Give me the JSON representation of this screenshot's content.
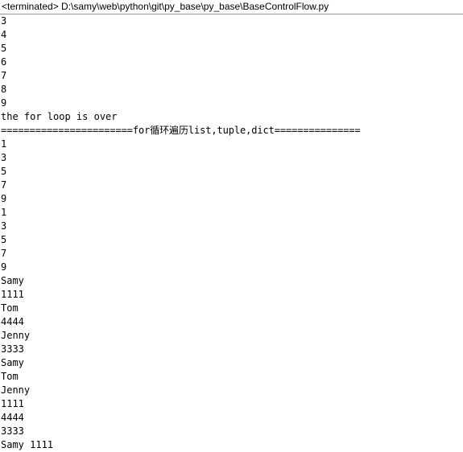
{
  "window": {
    "title": "<terminated> D:\\samy\\web\\python\\git\\py_base\\py_base\\BaseControlFlow.py",
    "view_name": "Console",
    "status": "terminated",
    "script_path": "D:\\samy\\web\\python\\git\\py_base\\py_base\\BaseControlFlow.py",
    "background_color": "#ffffff",
    "text_color": "#000000",
    "divider_color": "#9a9a9a"
  },
  "console": {
    "lines": [
      "3",
      "4",
      "5",
      "6",
      "7",
      "8",
      "9",
      "the for loop is over",
      "=======================for循环遍历list,tuple,dict===============",
      "1",
      "3",
      "5",
      "7",
      "9",
      "1",
      "3",
      "5",
      "7",
      "9",
      "Samy",
      "1111",
      "Tom",
      "4444",
      "Jenny",
      "3333",
      "Samy",
      "Tom",
      "Jenny",
      "1111",
      "4444",
      "3333",
      "Samy 1111"
    ]
  }
}
